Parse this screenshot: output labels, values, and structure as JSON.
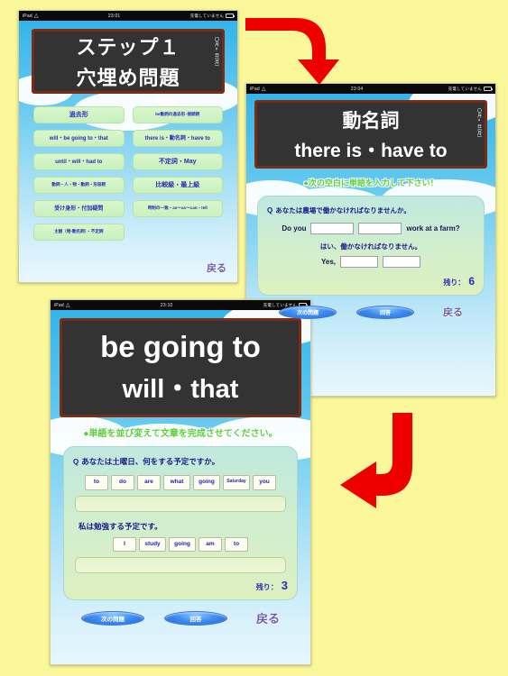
{
  "screens": {
    "menu": {
      "status": {
        "device": "iPad",
        "wifi_icon": "wifi-icon",
        "time": "23:01",
        "battery_text": "充電していません",
        "battery_icon": "battery-icon"
      },
      "title_line1": "ステップ１",
      "title_line2": "穴埋め問題",
      "date_label": "〇月×日(月)",
      "buttons": [
        {
          "label": "過去形",
          "size": "big"
        },
        {
          "label": "be動詞の過去形･接続詞",
          "size": "small"
        },
        {
          "label": "will・be going to・that",
          "size": "normal"
        },
        {
          "label": "there is・動名詞・have to",
          "size": "normal"
        },
        {
          "label": "until・will・had to",
          "size": "normal"
        },
        {
          "label": "不定詞・May",
          "size": "big"
        },
        {
          "label": "動詞・人・物・動詞・形容詞",
          "size": "small"
        },
        {
          "label": "比較級・最上級",
          "size": "big"
        },
        {
          "label": "受け身形・付加疑問",
          "size": "normal"
        },
        {
          "label": "時制の一致・as～as～can・tell",
          "size": "small"
        },
        {
          "label": "主語（物-動名詞）・不定詞",
          "size": "small"
        },
        {
          "label": "",
          "size": "normal"
        }
      ],
      "back_label": "戻る"
    },
    "fill_blank": {
      "status": {
        "device": "iPad",
        "wifi_icon": "wifi-icon",
        "time": "23:04",
        "battery_text": "充電していません",
        "battery_icon": "battery-icon"
      },
      "title_line1": "動名詞",
      "title_line2": "there is・have to",
      "date_label": "〇月×日(月)",
      "instruction": "●次の空白に単語を入力して下さい！",
      "question_mark": "Q",
      "question_ja": "あなたは農場で働かなければなりませんか。",
      "sentence_prefix": "Do you",
      "sentence_suffix": "work  at  a  farm?",
      "answer_ja": "はい、働かなければなりません。",
      "answer_prefix": "Yes,",
      "score_label": "残り：",
      "score_value": "6",
      "next_button": "次の問題",
      "submit_button": "回答",
      "back_label": "戻る"
    },
    "word_order": {
      "status": {
        "device": "iPad",
        "wifi_icon": "wifi-icon",
        "time": "23:10",
        "battery_text": "充電していません",
        "battery_icon": "battery-icon"
      },
      "title_line1": "be going to",
      "title_line2": "will・that",
      "instruction": "●単語を並び変えて文章を完成させてください。",
      "question_mark": "Q",
      "question_ja": "あなたは土曜日、何をする予定ですか。",
      "tiles_row1": [
        "to",
        "do",
        "are",
        "what",
        "going",
        "Saturday",
        "you"
      ],
      "answer_ja": "私は勉強する予定です。",
      "tiles_row2": [
        "I",
        "study",
        "going",
        "am",
        "to"
      ],
      "score_label": "残り：",
      "score_value": "3",
      "next_button": "次の問題",
      "submit_button": "回答",
      "back_label": "戻る"
    }
  },
  "annotations": {
    "arrow1": "red-curved-arrow-down-right",
    "arrow2": "red-curved-arrow-down-left"
  },
  "colors": {
    "page_background": "#faf79a",
    "arrow": "#ee0000",
    "plate_background": "#333333",
    "plate_border": "#7b2c12",
    "menu_button": "#d3f5c6",
    "menu_text": "#2a2ab8",
    "instruction_text": "#5ad03a",
    "pill_button": "#2f7fe6"
  }
}
